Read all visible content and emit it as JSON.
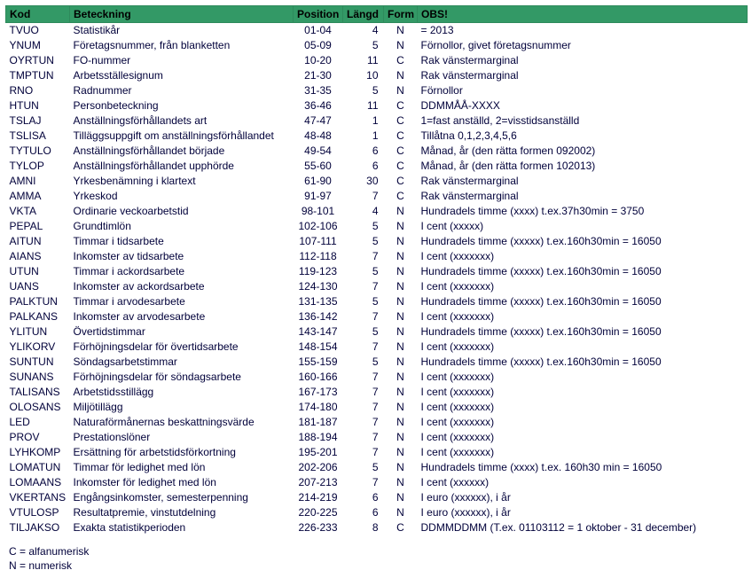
{
  "headers": {
    "kod": "Kod",
    "beteckning": "Beteckning",
    "position": "Position",
    "langd": "Längd",
    "form": "Form",
    "obs": "OBS!"
  },
  "rows": [
    {
      "kod": "TVUO",
      "bet": "Statistikår",
      "pos": "01-04",
      "lan": "4",
      "form": "N",
      "obs": "= 2013"
    },
    {
      "kod": "YNUM",
      "bet": "Företagsnummer, från blanketten",
      "pos": "05-09",
      "lan": "5",
      "form": "N",
      "obs": "Förnollor, givet företagsnummer"
    },
    {
      "kod": "OYRTUN",
      "bet": "FO-nummer",
      "pos": "10-20",
      "lan": "11",
      "form": "C",
      "obs": "Rak vänstermarginal"
    },
    {
      "kod": "TMPTUN",
      "bet": "Arbetsställesignum",
      "pos": "21-30",
      "lan": "10",
      "form": "N",
      "obs": "Rak vänstermarginal"
    },
    {
      "kod": "RNO",
      "bet": "Radnummer",
      "pos": "31-35",
      "lan": "5",
      "form": "N",
      "obs": "Förnollor"
    },
    {
      "kod": "HTUN",
      "bet": "Personbeteckning",
      "pos": "36-46",
      "lan": "11",
      "form": "C",
      "obs": "DDMMÅÅ-XXXX"
    },
    {
      "kod": "TSLAJ",
      "bet": "Anställningsförhållandets art",
      "pos": "47-47",
      "lan": "1",
      "form": "C",
      "obs": "1=fast anställd, 2=visstidsanställd"
    },
    {
      "kod": "TSLISA",
      "bet": "Tilläggsuppgift om anställningsförhållandet",
      "pos": "48-48",
      "lan": "1",
      "form": "C",
      "obs": "Tillåtna 0,1,2,3,4,5,6"
    },
    {
      "kod": "TYTULO",
      "bet": "Anställningsförhållandet började",
      "pos": "49-54",
      "lan": "6",
      "form": "C",
      "obs": "Månad, år (den rätta formen 092002)"
    },
    {
      "kod": "TYLOP",
      "bet": "Anställningsförhållandet upphörde",
      "pos": "55-60",
      "lan": "6",
      "form": "C",
      "obs": "Månad, år (den rätta formen 102013)"
    },
    {
      "kod": "AMNI",
      "bet": "Yrkesbenämning i klartext",
      "pos": "61-90",
      "lan": "30",
      "form": "C",
      "obs": "Rak vänstermarginal"
    },
    {
      "kod": "AMMA",
      "bet": "Yrkeskod",
      "pos": "91-97",
      "lan": "7",
      "form": "C",
      "obs": "Rak vänstermarginal"
    },
    {
      "kod": "VKTA",
      "bet": "Ordinarie veckoarbetstid",
      "pos": "98-101",
      "lan": "4",
      "form": "N",
      "obs": "Hundradels timme (xxxx) t.ex.37h30min = 3750"
    },
    {
      "kod": "PEPAL",
      "bet": "Grundtimlön",
      "pos": "102-106",
      "lan": "5",
      "form": "N",
      "obs": "I cent (xxxxx)"
    },
    {
      "kod": "AITUN",
      "bet": "Timmar i tidsarbete",
      "pos": "107-111",
      "lan": "5",
      "form": "N",
      "obs": "Hundradels timme (xxxxx) t.ex.160h30min = 16050"
    },
    {
      "kod": "AIANS",
      "bet": "Inkomster av tidsarbete",
      "pos": "112-118",
      "lan": "7",
      "form": "N",
      "obs": "I cent (xxxxxxx)"
    },
    {
      "kod": "UTUN",
      "bet": "Timmar i ackordsarbete",
      "pos": "119-123",
      "lan": "5",
      "form": "N",
      "obs": "Hundradels timme (xxxxx) t.ex.160h30min = 16050"
    },
    {
      "kod": "UANS",
      "bet": "Inkomster av ackordsarbete",
      "pos": "124-130",
      "lan": "7",
      "form": "N",
      "obs": "I cent (xxxxxxx)"
    },
    {
      "kod": "PALKTUN",
      "bet": "Timmar i arvodesarbete",
      "pos": "131-135",
      "lan": "5",
      "form": "N",
      "obs": "Hundradels timme (xxxxx) t.ex.160h30min = 16050"
    },
    {
      "kod": "PALKANS",
      "bet": "Inkomster av arvodesarbete",
      "pos": "136-142",
      "lan": "7",
      "form": "N",
      "obs": "I cent (xxxxxxx)"
    },
    {
      "kod": "YLITUN",
      "bet": "Övertidstimmar",
      "pos": "143-147",
      "lan": "5",
      "form": "N",
      "obs": "Hundradels timme (xxxxx) t.ex.160h30min = 16050"
    },
    {
      "kod": "YLIKORV",
      "bet": "Förhöjningsdelar för övertidsarbete",
      "pos": "148-154",
      "lan": "7",
      "form": "N",
      "obs": "I cent (xxxxxxx)"
    },
    {
      "kod": "SUNTUN",
      "bet": "Söndagsarbetstimmar",
      "pos": "155-159",
      "lan": "5",
      "form": "N",
      "obs": "Hundradels timme (xxxxx) t.ex.160h30min = 16050"
    },
    {
      "kod": "SUNANS",
      "bet": "Förhöjningsdelar för söndagsarbete",
      "pos": "160-166",
      "lan": "7",
      "form": "N",
      "obs": "I cent (xxxxxxx)"
    },
    {
      "kod": "TALISANS",
      "bet": "Arbetstidsstillägg",
      "pos": "167-173",
      "lan": "7",
      "form": "N",
      "obs": "I cent (xxxxxxx)"
    },
    {
      "kod": "OLOSANS",
      "bet": "Miljötillägg",
      "pos": "174-180",
      "lan": "7",
      "form": "N",
      "obs": "I cent (xxxxxxx)"
    },
    {
      "kod": "LED",
      "bet": "Naturaförmånernas beskattningsvärde",
      "pos": "181-187",
      "lan": "7",
      "form": "N",
      "obs": "I cent (xxxxxxx)"
    },
    {
      "kod": "PROV",
      "bet": "Prestationslöner",
      "pos": "188-194",
      "lan": "7",
      "form": "N",
      "obs": "I cent (xxxxxxx)"
    },
    {
      "kod": "LYHKOMP",
      "bet": "Ersättning för arbetstidsförkortning",
      "pos": "195-201",
      "lan": "7",
      "form": "N",
      "obs": "I cent (xxxxxxx)"
    },
    {
      "kod": "LOMATUN",
      "bet": "Timmar för ledighet med lön",
      "pos": "202-206",
      "lan": "5",
      "form": "N",
      "obs": "Hundradels timme (xxxx)  t.ex. 160h30 min = 16050"
    },
    {
      "kod": "LOMAANS",
      "bet": "Inkomster för ledighet med lön",
      "pos": "207-213",
      "lan": "7",
      "form": "N",
      "obs": "I cent (xxxxxx)"
    },
    {
      "kod": "VKERTANS",
      "bet": "Engångsinkomster, semesterpenning",
      "pos": "214-219",
      "lan": "6",
      "form": "N",
      "obs": "I euro (xxxxxx), i år"
    },
    {
      "kod": "VTULOSP",
      "bet": "Resultatpremie, vinstutdelning",
      "pos": "220-225",
      "lan": "6",
      "form": "N",
      "obs": "I euro (xxxxxx), i år"
    },
    {
      "kod": "TILJAKSO",
      "bet": "Exakta statistikperioden",
      "pos": "226-233",
      "lan": "8",
      "form": "C",
      "obs": "DDMMDDMM (T.ex. 01103112 = 1 oktober - 31 december)"
    }
  ],
  "legend": {
    "c": "C = alfanumerisk",
    "n": "N = numerisk"
  }
}
